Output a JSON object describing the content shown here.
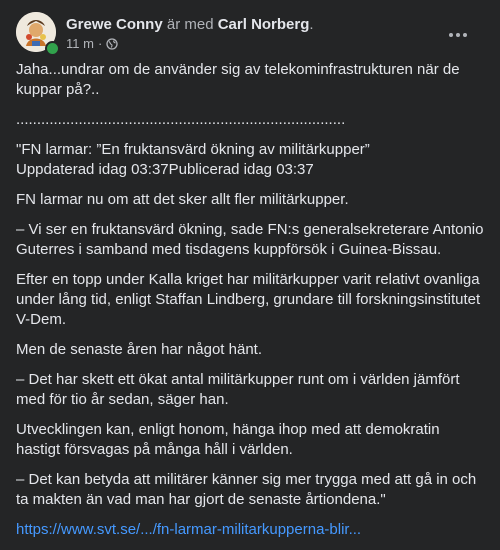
{
  "post": {
    "author": "Grewe Conny",
    "with_text": "är med",
    "tagged": "Carl Norberg",
    "period": ".",
    "time": "11 m",
    "separator": "·",
    "audience_icon": "globe-icon",
    "more_icon": "more-horizontal-icon",
    "paragraphs": [
      "Jaha...undrar om de använder sig av telekominfrastrukturen när de kuppar på?..",
      "...............................................................................",
      "\"FN larmar: ”En fruktansvärd ökning av militärkupper”\nUppdaterad idag 03:37Publicerad idag 03:37",
      "FN larmar nu om att det sker allt fler militärkupper.",
      "– Vi ser en fruktansvärd ökning, sade FN:s generalsekreterare Antonio Guterres i samband med tisdagens kuppförsök i Guinea-Bissau.",
      "Efter en topp under Kalla kriget har militärkupper varit relativt ovanliga under lång tid, enligt Staffan Lindberg, grundare till forskningsinstitutet V-Dem.",
      "Men de senaste åren har något hänt.",
      "– Det har skett ett ökat antal militärkupper runt om i världen jämfört med för tio år sedan, säger han.",
      "Utvecklingen kan, enligt honom, hänga ihop med att demokratin hastigt försvagas på många håll i världen.",
      "– Det kan betyda att militärer känner sig mer trygga med att gå in och ta makten än vad man har gjort de senaste årtiondena.\""
    ],
    "link": "https://www.svt.se/.../fn-larmar-militarkupperna-blir..."
  },
  "colors": {
    "background": "#242526",
    "text": "#e4e6eb",
    "secondary": "#b0b3b8",
    "link": "#4599ff",
    "online": "#31a24c"
  }
}
